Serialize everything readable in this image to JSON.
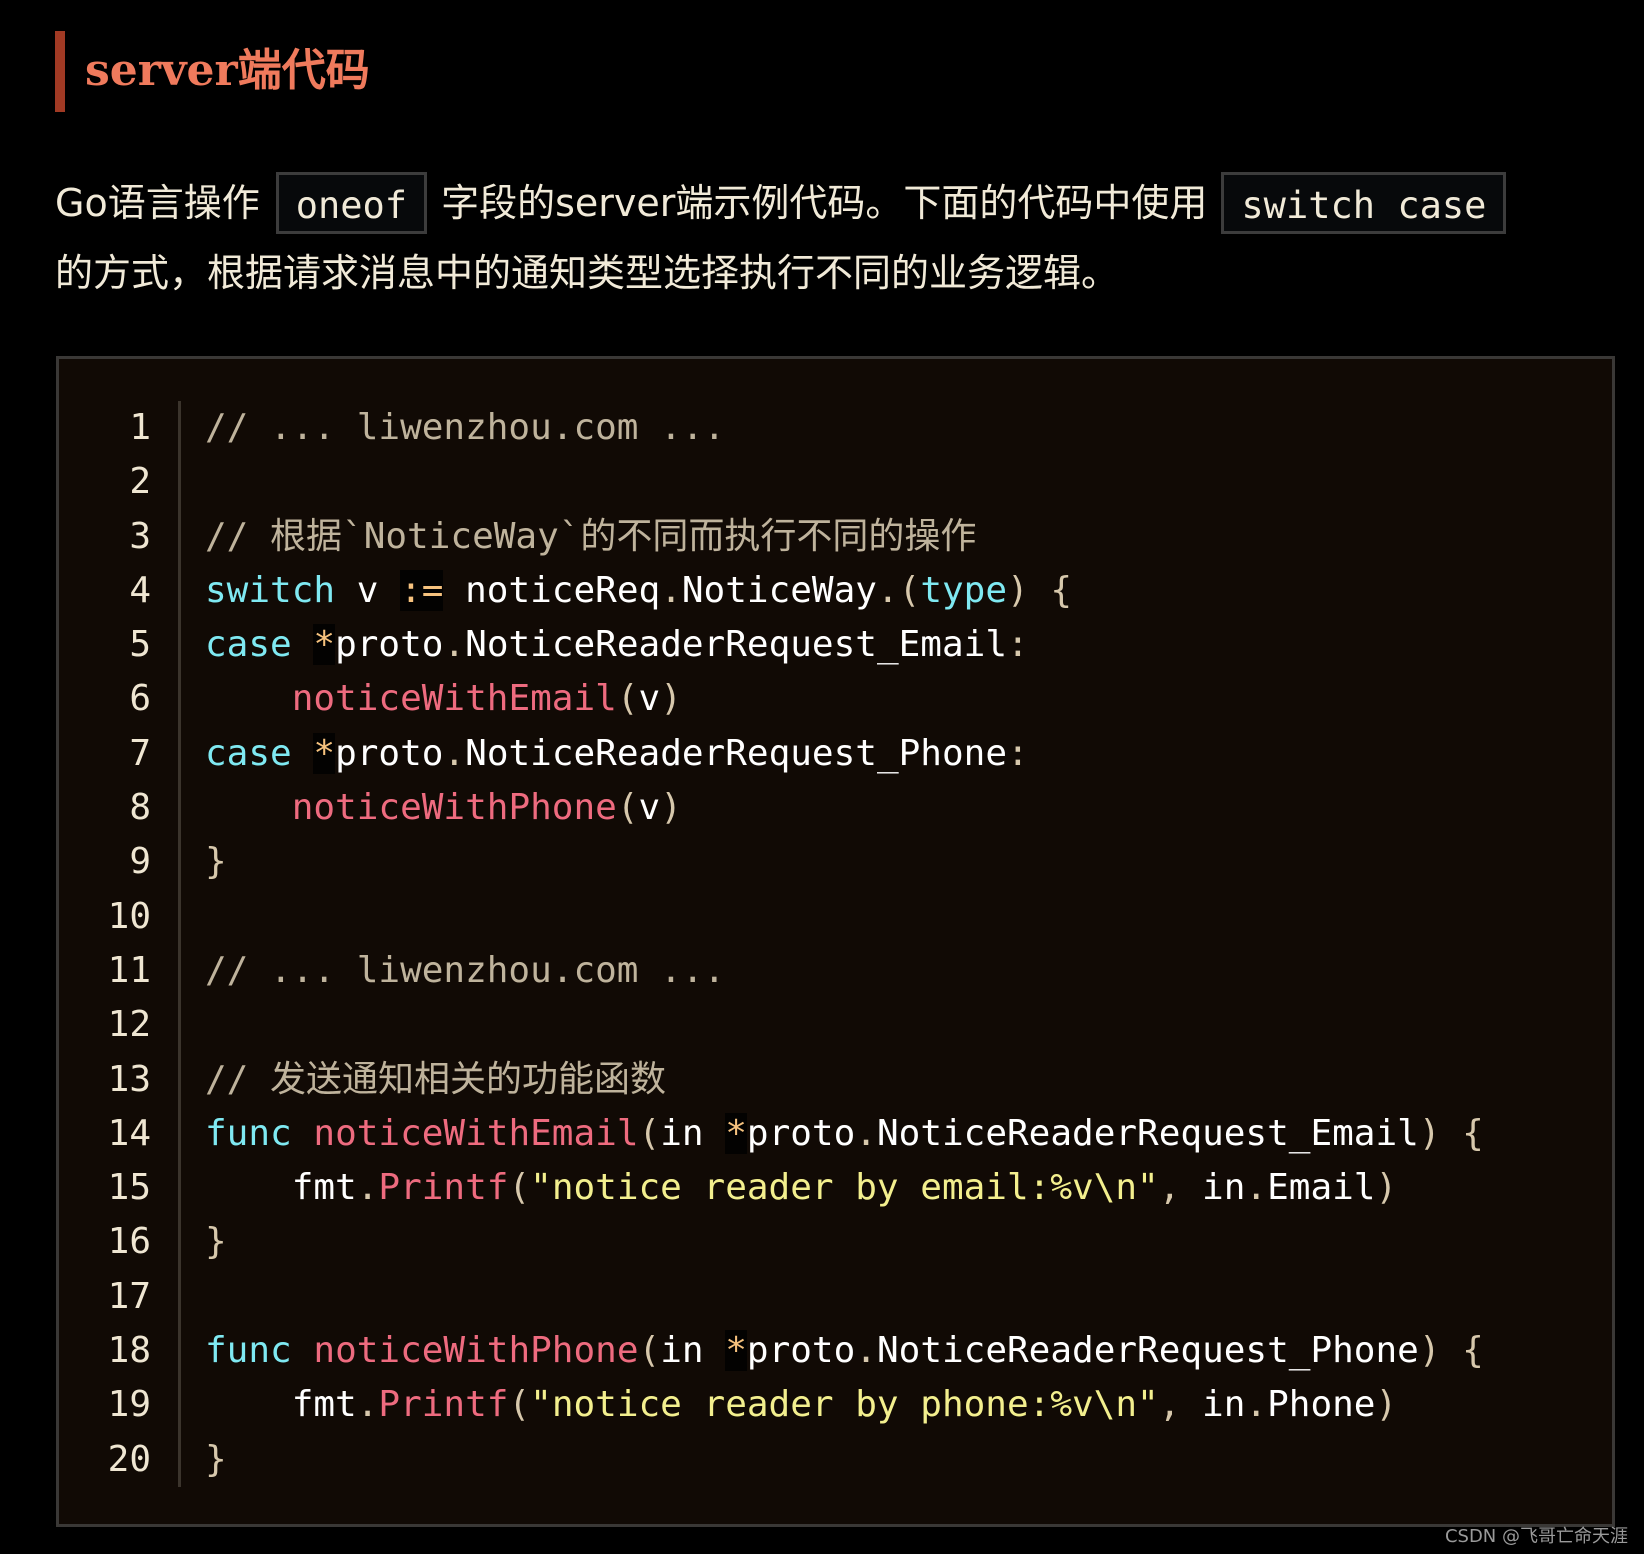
{
  "heading": "server端代码",
  "paragraph": {
    "part1": "Go语言操作",
    "code1": "oneof",
    "part2": "字段的server端示例代码。下面的代码中使用",
    "code2": "switch case",
    "part3": "的方式，根据请求消息中的通知类型选择执行不同的业务逻辑。"
  },
  "colors": {
    "accent": "#ef7a5c",
    "keyword": "#7fe9f2",
    "function": "#ee6b7f",
    "string": "#f3ef8e",
    "comment": "#bfb39c",
    "code_bg": "#110a05"
  },
  "code": {
    "lines": [
      {
        "n": "1",
        "tokens": [
          [
            "c",
            "// ... liwenzhou.com ..."
          ]
        ]
      },
      {
        "n": "2",
        "tokens": []
      },
      {
        "n": "3",
        "tokens": [
          [
            "c",
            "// 根据`NoticeWay`的不同而执行不同的操作"
          ]
        ]
      },
      {
        "n": "4",
        "tokens": [
          [
            "k",
            "switch"
          ],
          [
            "i",
            " v "
          ],
          [
            "o",
            ":="
          ],
          [
            "i",
            " noticeReq"
          ],
          [
            "p",
            "."
          ],
          [
            "i",
            "NoticeWay"
          ],
          [
            "p",
            ".("
          ],
          [
            "k",
            "type"
          ],
          [
            "p",
            ") {"
          ]
        ]
      },
      {
        "n": "5",
        "tokens": [
          [
            "k",
            "case"
          ],
          [
            "i",
            " "
          ],
          [
            "o",
            "*"
          ],
          [
            "i",
            "proto"
          ],
          [
            "p",
            "."
          ],
          [
            "i",
            "NoticeReaderRequest_Email"
          ],
          [
            "p",
            ":"
          ]
        ]
      },
      {
        "n": "6",
        "tokens": [
          [
            "i",
            "    "
          ],
          [
            "f",
            "noticeWithEmail"
          ],
          [
            "p",
            "("
          ],
          [
            "i",
            "v"
          ],
          [
            "p",
            ")"
          ]
        ]
      },
      {
        "n": "7",
        "tokens": [
          [
            "k",
            "case"
          ],
          [
            "i",
            " "
          ],
          [
            "o",
            "*"
          ],
          [
            "i",
            "proto"
          ],
          [
            "p",
            "."
          ],
          [
            "i",
            "NoticeReaderRequest_Phone"
          ],
          [
            "p",
            ":"
          ]
        ]
      },
      {
        "n": "8",
        "tokens": [
          [
            "i",
            "    "
          ],
          [
            "f",
            "noticeWithPhone"
          ],
          [
            "p",
            "("
          ],
          [
            "i",
            "v"
          ],
          [
            "p",
            ")"
          ]
        ]
      },
      {
        "n": "9",
        "tokens": [
          [
            "p",
            "}"
          ]
        ]
      },
      {
        "n": "10",
        "tokens": []
      },
      {
        "n": "11",
        "tokens": [
          [
            "c",
            "// ... liwenzhou.com ..."
          ]
        ]
      },
      {
        "n": "12",
        "tokens": []
      },
      {
        "n": "13",
        "tokens": [
          [
            "c",
            "// 发送通知相关的功能函数"
          ]
        ]
      },
      {
        "n": "14",
        "tokens": [
          [
            "k",
            "func"
          ],
          [
            "i",
            " "
          ],
          [
            "f",
            "noticeWithEmail"
          ],
          [
            "p",
            "("
          ],
          [
            "i",
            "in "
          ],
          [
            "o",
            "*"
          ],
          [
            "i",
            "proto"
          ],
          [
            "p",
            "."
          ],
          [
            "i",
            "NoticeReaderRequest_Email"
          ],
          [
            "p",
            ") {"
          ]
        ]
      },
      {
        "n": "15",
        "tokens": [
          [
            "i",
            "    fmt"
          ],
          [
            "p",
            "."
          ],
          [
            "f",
            "Printf"
          ],
          [
            "p",
            "("
          ],
          [
            "s",
            "\"notice reader by email:%v\\n\""
          ],
          [
            "p",
            ", "
          ],
          [
            "i",
            "in"
          ],
          [
            "p",
            "."
          ],
          [
            "i",
            "Email"
          ],
          [
            "p",
            ")"
          ]
        ]
      },
      {
        "n": "16",
        "tokens": [
          [
            "p",
            "}"
          ]
        ]
      },
      {
        "n": "17",
        "tokens": []
      },
      {
        "n": "18",
        "tokens": [
          [
            "k",
            "func"
          ],
          [
            "i",
            " "
          ],
          [
            "f",
            "noticeWithPhone"
          ],
          [
            "p",
            "("
          ],
          [
            "i",
            "in "
          ],
          [
            "o",
            "*"
          ],
          [
            "i",
            "proto"
          ],
          [
            "p",
            "."
          ],
          [
            "i",
            "NoticeReaderRequest_Phone"
          ],
          [
            "p",
            ") {"
          ]
        ]
      },
      {
        "n": "19",
        "tokens": [
          [
            "i",
            "    fmt"
          ],
          [
            "p",
            "."
          ],
          [
            "f",
            "Printf"
          ],
          [
            "p",
            "("
          ],
          [
            "s",
            "\"notice reader by phone:%v\\n\""
          ],
          [
            "p",
            ", "
          ],
          [
            "i",
            "in"
          ],
          [
            "p",
            "."
          ],
          [
            "i",
            "Phone"
          ],
          [
            "p",
            ")"
          ]
        ]
      },
      {
        "n": "20",
        "tokens": [
          [
            "p",
            "}"
          ]
        ]
      }
    ]
  },
  "watermark": "CSDN @飞哥亡命天涯"
}
